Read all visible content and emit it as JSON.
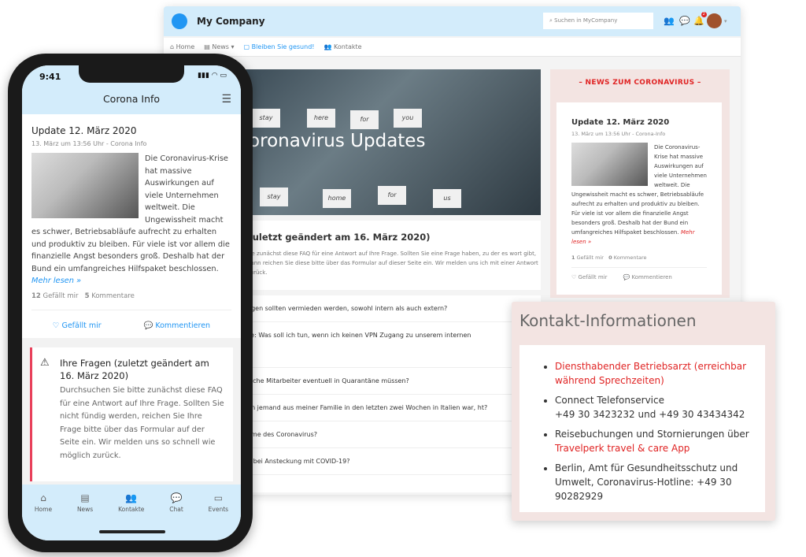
{
  "desktop": {
    "company": "My Company",
    "search_placeholder": "Suchen in MyCompany",
    "notif_count": "2",
    "nav": [
      "Home",
      "News",
      "Bleiben Sie gesund!",
      "Kontakte"
    ],
    "hero_title": "Coronavirus Updates",
    "hero_signs": [
      "stay",
      "here",
      "for",
      "you",
      "stay",
      "home",
      "for",
      "us"
    ],
    "faq_title": "zuletzt geändert am 16. März 2020)",
    "faq_text": "tte zunächst diese FAQ für eine Antwort auf Ihre Frage. Sollten Sie eine Frage haben, zu der es wort gibt, dann reichen Sie diese bitte über das Formular auf dieser Seite ein. Wir melden uns ich mit einer Antwort zurück.",
    "questions": [
      "ngen sollten vermieden werden, sowohl intern als auch extern?",
      "se: Was soll ich tun, wenn ich keinen VPN Zugang zu unserem internen",
      "elche Mitarbeiter eventuell in Quarantäne müssen?",
      "nn jemand aus meiner Familie in den letzten zwei Wochen in Italien war, ht?",
      "ome des Coronavirus?",
      "n bei Ansteckung mit COVID-19?"
    ],
    "sidebar": {
      "heading": "– NEWS ZUM CORONAVIRUS –",
      "title": "Update 12. März 2020",
      "meta": "13. März um 13:56 Uhr - Corona-Info",
      "text": "Die Coronavirus-Krise hat massive Auswirkungen auf viele Unternehmen weltweit. Die Ungewissheit macht es schwer, Betriebsabläufe aufrecht zu erhalten und produktiv zu bleiben. Für viele ist vor allem die finanzielle Angst besonders groß. Deshalb hat der Bund ein umfangreiches Hilfspaket beschlossen.",
      "more": "Mehr lesen »",
      "likes": "1",
      "likes_label": "Gefällt mir",
      "comments": "0",
      "comments_label": "Kommentare",
      "like_btn": "Gefällt mir",
      "comment_btn": "Kommentieren"
    }
  },
  "kontakt": {
    "title": "Kontakt-Informationen",
    "items": [
      {
        "red": "Diensthabender Betriebsarzt (erreichbar während Sprechzeiten)",
        "text": ""
      },
      {
        "text": "Connect Telefonservice\n+49 30 3423232 und +49 30 43434342",
        "red": ""
      },
      {
        "text": "Reisebuchungen und Stornierungen über",
        "red": "Travelperk travel & care App"
      },
      {
        "text": "Berlin, Amt für Gesundheitsschutz und Umwelt, Coronavirus-Hotline: +49 30 90282929",
        "red": ""
      }
    ]
  },
  "phone": {
    "time": "9:41",
    "title": "Corona Info",
    "post_title": "Update 12. März 2020",
    "meta": "13. März um 13:56 Uhr - Corona Info",
    "text": "Die Coronavirus-Krise hat massive Auswirkungen auf viele Unternehmen weltweit. Die Ungewissheit macht es schwer, Betriebsabläufe aufrecht zu erhalten und produktiv zu bleiben. Für viele ist vor allem die finanzielle Angst besonders groß. Deshalb hat der Bund ein umfangreiches Hilfspaket beschlossen.",
    "more": "Mehr lesen »",
    "likes": "12",
    "likes_label": "Gefällt mir",
    "comments": "5",
    "comments_label": "Kommentare",
    "like_btn": "Gefällt mir",
    "comment_btn": "Kommentieren",
    "faq_title": "Ihre Fragen (zuletzt geändert am 16. März 2020)",
    "faq_text": "Durchsuchen Sie bitte zunächst diese FAQ für eine Antwort auf Ihre Frage. Sollten Sie nicht fündig werden, reichen Sie Ihre Frage bitte über das Formular auf der Seite ein. Wir melden uns so schnell wie möglich zurück.",
    "tabs": [
      "Home",
      "News",
      "Kontakte",
      "Chat",
      "Events"
    ]
  }
}
